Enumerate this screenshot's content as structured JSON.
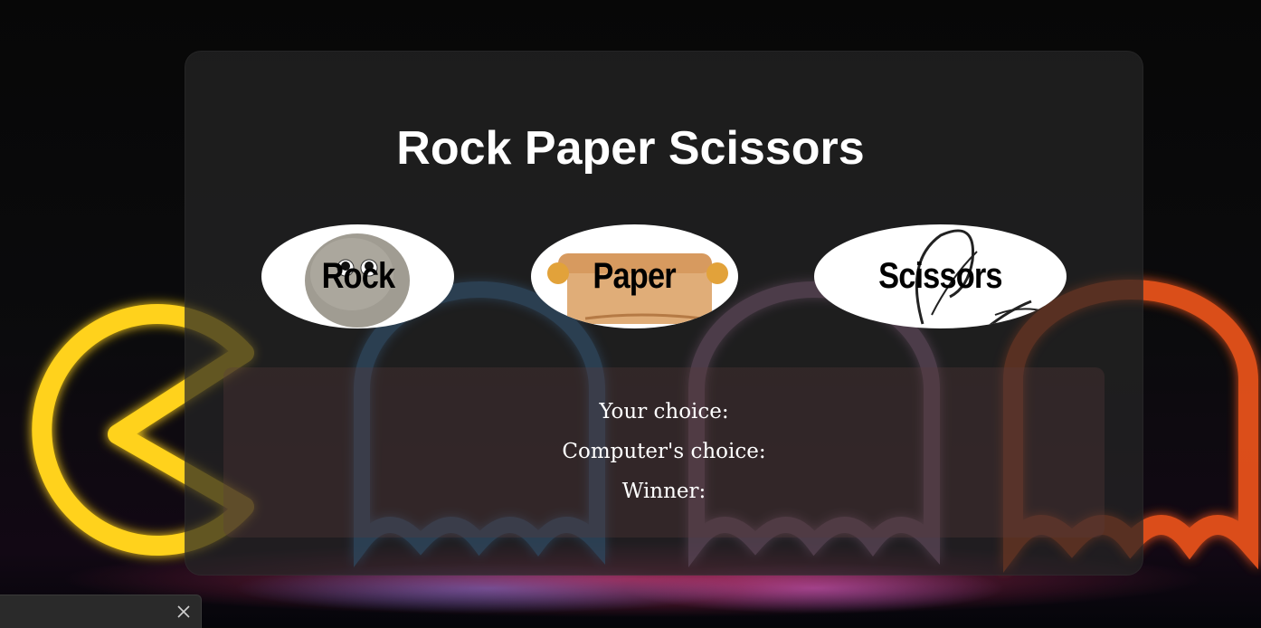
{
  "title": "Rock Paper Scissors",
  "choices": [
    {
      "id": "rock",
      "label": "Rock"
    },
    {
      "id": "paper",
      "label": "Paper"
    },
    {
      "id": "scissors",
      "label": "Scissors"
    }
  ],
  "results": {
    "your_choice_label": "Your choice:",
    "computer_choice_label": "Computer's choice:",
    "winner_label": "Winner:"
  },
  "colors": {
    "card_bg": "#262626",
    "text": "#ffffff",
    "pacman": "#ffd21a",
    "ghost_blue": "#4aa8ff",
    "ghost_pink": "#e69bd8",
    "ghost_orange": "#ff5a1f"
  },
  "toast": {
    "close_icon": "close-icon"
  }
}
